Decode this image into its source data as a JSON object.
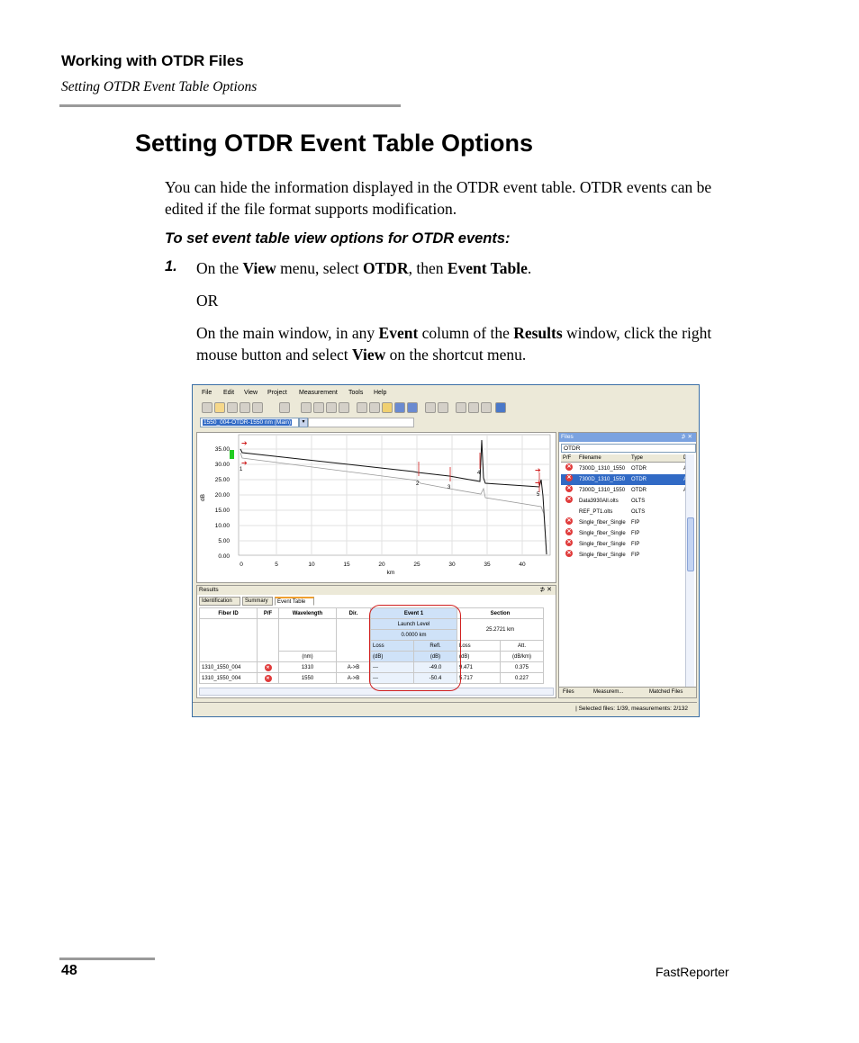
{
  "header": {
    "chapter": "Working with OTDR Files",
    "section": "Setting OTDR Event Table Options"
  },
  "page_title": "Setting OTDR Event Table Options",
  "intro": "You can hide the information displayed in the OTDR event table. OTDR events can be edited if the file format supports modification.",
  "procedure_title": "To set event table view options for OTDR events:",
  "step1": {
    "number": "1.",
    "t1": "On the ",
    "b1": "View",
    "t2": " menu, select ",
    "b2": "OTDR",
    "t3": ", then ",
    "b3": "Event Table",
    "t4": "."
  },
  "or": "OR",
  "alt": {
    "t1": "On the main window, in any ",
    "b1": "Event",
    "t2": " column of the ",
    "b2": "Results",
    "t3": " window, click the right mouse button and select ",
    "b3": "View",
    "t4": " on the shortcut menu."
  },
  "app": {
    "menu": [
      "File",
      "Edit",
      "View",
      "Project",
      "Measurement",
      "Tools",
      "Help"
    ],
    "trace_select": "1550_004-OTDR-1550 nm (Main)",
    "graph": {
      "ylabel": "dB",
      "xlabel": "km",
      "yticks": [
        "35.00",
        "30.00",
        "25.00",
        "20.00",
        "15.00",
        "10.00",
        "5.00",
        "0.00"
      ],
      "xticks": [
        "0",
        "5",
        "10",
        "15",
        "20",
        "25",
        "30",
        "35",
        "40"
      ],
      "markers": [
        "1",
        "2",
        "3",
        "4",
        "5"
      ]
    },
    "results": {
      "title": "Results",
      "controls": "⊅ ✕",
      "tabs": [
        "Identification",
        "Summary",
        "Event Table"
      ],
      "headers": {
        "fiber_id": "Fiber ID",
        "pf": "P/F",
        "wavelength": "Wavelength",
        "dir": "Dir.",
        "event": "Event 1",
        "section": "Section",
        "launch": "Launch Level",
        "pos": "0.0000 km",
        "section_len": "25.2721 km",
        "loss": "Loss",
        "refl": "Refl.",
        "sloss": "Loss",
        "att": "Att.",
        "nm": "(nm)",
        "db1": "(dB)",
        "db2": "(dB)",
        "db3": "(dB)",
        "dbkm": "(dB/km)"
      },
      "rows": [
        {
          "fiber": "1310_1550_004",
          "wl": "1310",
          "dir": "A->B",
          "loss": "---",
          "refl": "-49.0",
          "sloss": "9.471",
          "att": "0.375"
        },
        {
          "fiber": "1310_1550_004",
          "wl": "1550",
          "dir": "A->B",
          "loss": "---",
          "refl": "-50.4",
          "sloss": "5.717",
          "att": "0.227"
        }
      ]
    },
    "files": {
      "title": "Files",
      "controls": "⊅ ✕",
      "filter": "OTDR",
      "headers": [
        "P/F",
        "Filename",
        "Type",
        "D"
      ],
      "rows": [
        {
          "fail": true,
          "name": "7300D_1310_1550",
          "type": "OTDR",
          "d": "A",
          "selected": false
        },
        {
          "fail": true,
          "name": "7300D_1310_1550",
          "type": "OTDR",
          "d": "A",
          "selected": true
        },
        {
          "fail": true,
          "name": "7300D_1310_1550",
          "type": "OTDR",
          "d": "A",
          "selected": false
        },
        {
          "fail": true,
          "name": "Data3930All.olts",
          "type": "OLTS",
          "d": "",
          "selected": false
        },
        {
          "fail": false,
          "name": "REF_PT1.olts",
          "type": "OLTS",
          "d": "",
          "selected": false
        },
        {
          "fail": true,
          "name": "Single_fiber_Single",
          "type": "FIP",
          "d": "",
          "selected": false
        },
        {
          "fail": true,
          "name": "Single_fiber_Single",
          "type": "FIP",
          "d": "",
          "selected": false
        },
        {
          "fail": true,
          "name": "Single_fiber_Single",
          "type": "FIP",
          "d": "",
          "selected": false
        },
        {
          "fail": true,
          "name": "Single_fiber_Single",
          "type": "FIP",
          "d": "",
          "selected": false
        }
      ],
      "bottom_tabs": [
        "Files",
        "Measurem...",
        "Matched Files"
      ]
    },
    "status": "| Selected files: 1/39, measurements: 2/132"
  },
  "footer": {
    "page_number": "48",
    "product": "FastReporter"
  }
}
